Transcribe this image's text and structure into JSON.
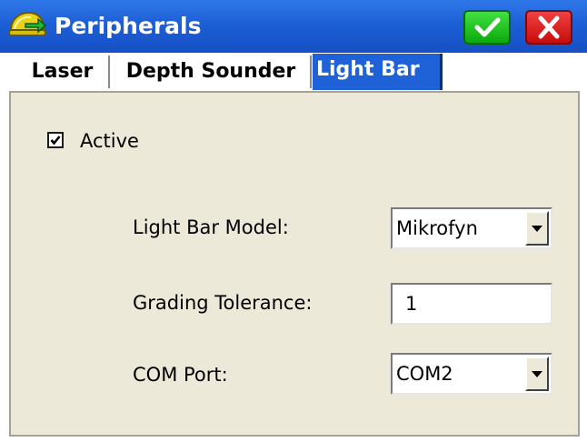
{
  "window": {
    "title": "Peripherals",
    "app_icon": "surveyor-helmet-icon",
    "ok_icon": "checkmark-icon",
    "cancel_icon": "close-icon",
    "accent": "#1d5fd6"
  },
  "tabs": [
    {
      "label": "Laser",
      "selected": false
    },
    {
      "label": "Depth Sounder",
      "selected": false
    },
    {
      "label": "Light Bar",
      "selected": true
    }
  ],
  "form": {
    "active": {
      "label": "Active",
      "checked": true
    },
    "light_bar_model": {
      "label": "Light Bar Model:",
      "value": "Mikrofyn"
    },
    "grading_tolerance": {
      "label": "Grading Tolerance:",
      "value": "1"
    },
    "com_port": {
      "label": "COM Port:",
      "value": "COM2"
    }
  }
}
